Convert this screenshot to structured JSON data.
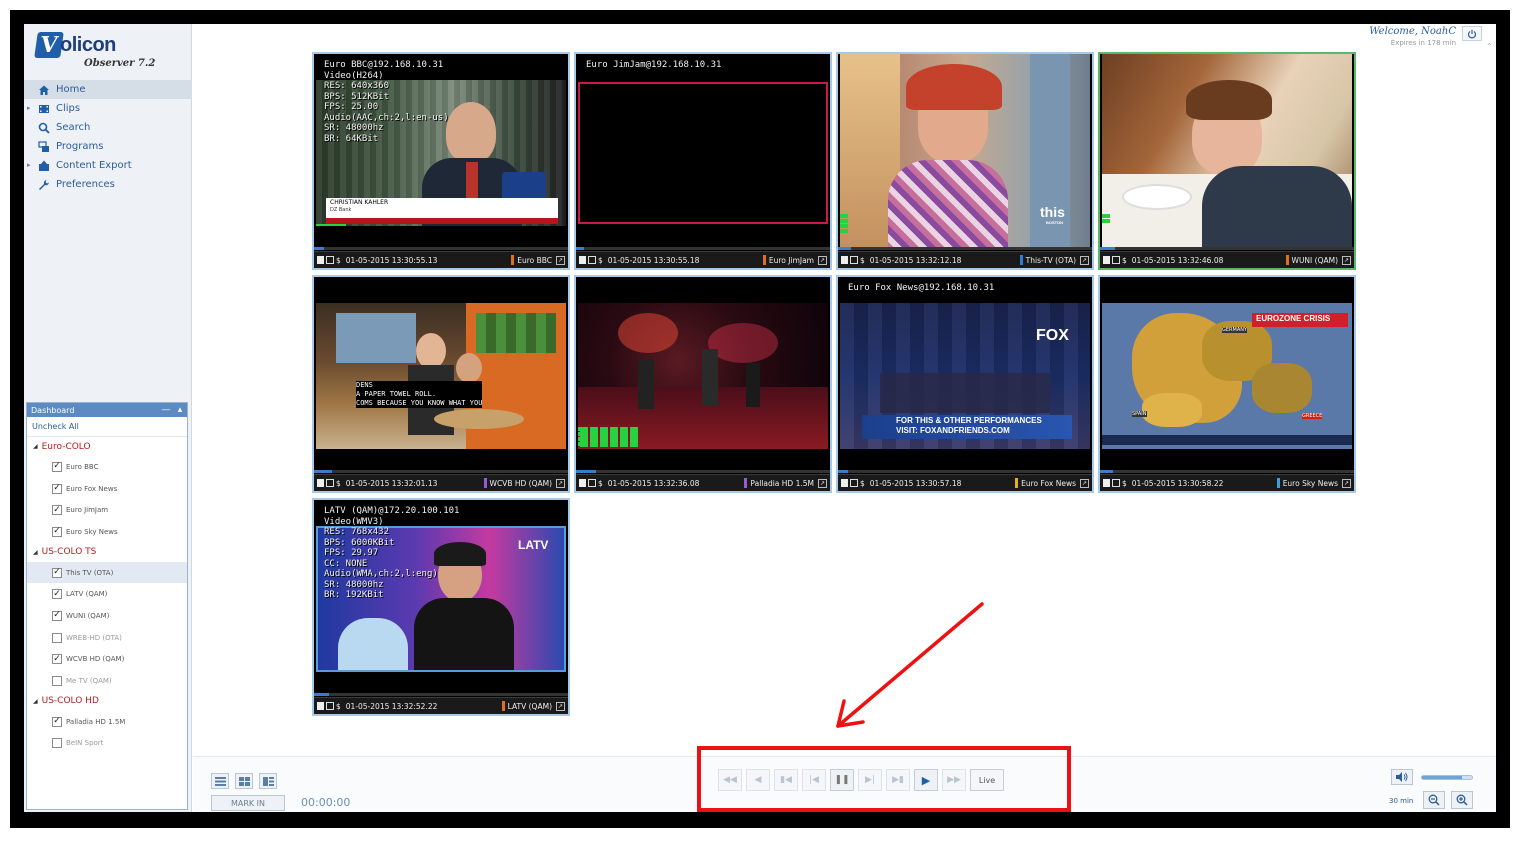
{
  "app": {
    "logo_mark": "V",
    "logo_word": "olicon",
    "logo_sub": "Observer 7.2",
    "welcome": "Welcome, NoahC",
    "expires": "Expires in 178 min"
  },
  "nav": [
    {
      "label": "Home",
      "icon": "home-icon",
      "active": true,
      "caret": false
    },
    {
      "label": "Clips",
      "icon": "clips-icon",
      "active": false,
      "caret": true
    },
    {
      "label": "Search",
      "icon": "search-icon",
      "active": false,
      "caret": false
    },
    {
      "label": "Programs",
      "icon": "programs-icon",
      "active": false,
      "caret": false
    },
    {
      "label": "Content Export",
      "icon": "export-icon",
      "active": false,
      "caret": true
    },
    {
      "label": "Preferences",
      "icon": "wrench-icon",
      "active": false,
      "caret": false
    }
  ],
  "dashboard": {
    "title": "Dashboard",
    "uncheck_all": "Uncheck All",
    "groups": [
      {
        "name": "Euro-COLO",
        "channels": [
          {
            "label": "Euro BBC",
            "checked": true
          },
          {
            "label": "Euro Fox News",
            "checked": true
          },
          {
            "label": "Euro JimJam",
            "checked": true
          },
          {
            "label": "Euro Sky News",
            "checked": true
          }
        ]
      },
      {
        "name": "US-COLO TS",
        "channels": [
          {
            "label": "This TV (OTA)",
            "checked": true,
            "highlight": true
          },
          {
            "label": "LATV (QAM)",
            "checked": true
          },
          {
            "label": "WUNI (QAM)",
            "checked": true
          },
          {
            "label": "WREB-HD (OTA)",
            "checked": false
          },
          {
            "label": "WCVB HD (QAM)",
            "checked": true
          },
          {
            "label": "Me TV (QAM)",
            "checked": false
          }
        ]
      },
      {
        "name": "US-COLO HD",
        "channels": [
          {
            "label": "Palladia HD 1.5M",
            "checked": true
          },
          {
            "label": "BeIN Sport",
            "checked": false
          }
        ]
      }
    ]
  },
  "tiles": [
    {
      "timestamp": "01-05-2015 13:30:55.13",
      "channel": "Euro BBC",
      "chan_color": "#e07020",
      "osd": "Euro BBC@192.168.10.31\nVideo(H264)\nRES: 640x360\nBPS: 512KBit\nFPS: 25.00\nAudio(AAC,ch:2,l:en-us)\nSR: 48000hz\nBR: 64KBit",
      "caption1": "CHRISTIAN KAHLER",
      "caption2": "DZ Bank",
      "progress": 0.04
    },
    {
      "timestamp": "01-05-2015 13:30:55.18",
      "channel": "Euro JimJam",
      "chan_color": "#e07020",
      "osd": "Euro JimJam@192.168.10.31",
      "progress": 0.03
    },
    {
      "timestamp": "01-05-2015 13:32:12.18",
      "channel": "This-TV (OTA)",
      "chan_color": "#2a7fd4",
      "bug_main": "this",
      "bug_sub": "BOSTON",
      "progress": 0.05
    },
    {
      "timestamp": "01-05-2015 13:32:46.08",
      "channel": "WUNI (QAM)",
      "chan_color": "#e07020",
      "progress": 0.06
    },
    {
      "timestamp": "01-05-2015 13:32:01.13",
      "channel": "WCVB HD (QAM)",
      "chan_color": "#9b59d6",
      "cc": "DENS\nA PAPER TOWEL ROLL.\nCOMS BECAUSE YOU KNOW WHAT YOU",
      "progress": 0.07
    },
    {
      "timestamp": "01-05-2015 13:32:36.08",
      "channel": "Palladia HD 1.5M",
      "chan_color": "#9b59d6",
      "progress": 0.08
    },
    {
      "timestamp": "01-05-2015 13:30:57.18",
      "channel": "Euro Fox News",
      "chan_color": "#e0b020",
      "osd": "Euro Fox News@192.168.10.31",
      "fox_logo": "FOX",
      "fox_strip1": "FOR THIS & OTHER PERFORMANCES",
      "fox_strip2": "VISIT: FOXANDFRIENDS.COM",
      "progress": 0.04
    },
    {
      "timestamp": "01-05-2015 13:30:58.22",
      "channel": "Euro Sky News",
      "chan_color": "#3aa0e0",
      "map_title": "EUROZONE CRISIS",
      "map_label1": "GERMANY",
      "map_label2": "SPAIN",
      "map_label3": "GREECE",
      "progress": 0.05
    },
    {
      "timestamp": "01-05-2015 13:32:52.22",
      "channel": "LATV (QAM)",
      "chan_color": "#e07020",
      "osd": "LATV (QAM)@172.20.100.101\nVideo(WMV3)\nRES: 768x432\nBPS: 6000KBit\nFPS: 29.97\nCC: NONE\nAudio(WMA,ch:2,l:eng)\nSR: 48000hz\nBR: 192KBit",
      "bug_main": "LATV",
      "progress": 0.06
    }
  ],
  "bottom": {
    "mark_in": "MARK IN",
    "timecode": "00:00:00",
    "live": "Live",
    "zoom_label": "30 min",
    "volume_level": 0.8
  },
  "colors": {
    "accent": "#1f5ea8",
    "callout": "#ee1111",
    "tile_border": "#a8c8e8",
    "meter": "#27d140"
  }
}
